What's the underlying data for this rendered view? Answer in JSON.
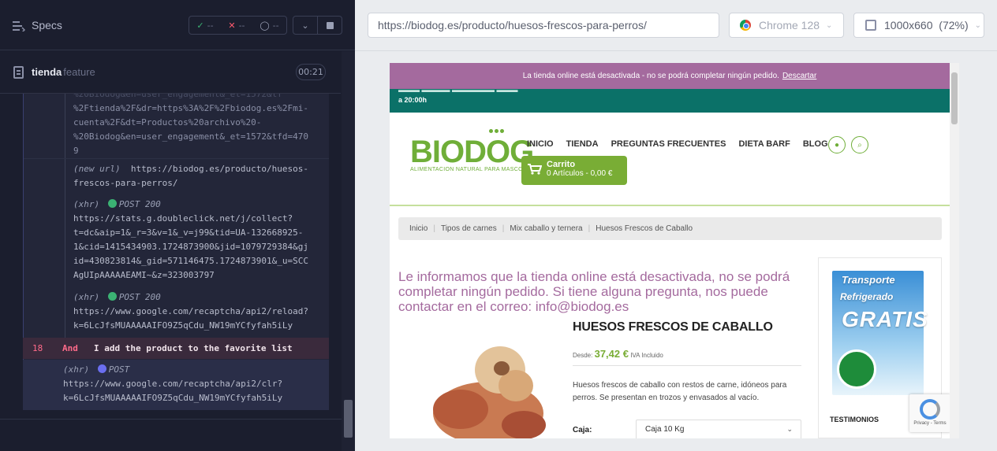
{
  "specs_bar": {
    "title": "Specs",
    "passed": "--",
    "failed": "--",
    "pending": "--"
  },
  "spec": {
    "name": "tienda",
    "type": "feature",
    "timer": "00:21"
  },
  "log": {
    "block1": [
      "%2Ftienda%2F&dr=https%3A%2F%2Fbiodog.es%2Fmi-",
      "cuenta%2F&dt=Productos%20archivo%20-",
      "%20Biodog&en=user_engagement&_et=1572&tfd=470",
      "9"
    ],
    "new_url_label": "(new url)",
    "new_url": "https://biodog.es/producto/huesos-frescos-para-perros/",
    "new_url_line1": "https://biodog.es/producto/huesos-",
    "new_url_line2": "frescos-para-perros/",
    "xhr1_label": "(xhr)",
    "xhr1_method": "POST 200",
    "xhr1_lines": [
      "https://stats.g.doubleclick.net/j/collect?",
      "t=dc&aip=1&_r=3&v=1&_v=j99&tid=UA-132668925-",
      "1&cid=1415434903.1724873900&jid=1079729384&gj",
      "id=430823814&_gid=571146475.1724873901&_u=SCC",
      "AgUIpAAAAAEAMI~&z=323003797"
    ],
    "xhr2_label": "(xhr)",
    "xhr2_method": "POST 200",
    "xhr2_lines": [
      "https://www.google.com/recaptcha/api2/reload?",
      "k=6LcJfsMUAAAAAIFO9Z5qCdu_NW19mYCfyfah5iLy"
    ]
  },
  "step": {
    "number": "18",
    "keyword": "And",
    "text": "I add the product to the favorite list"
  },
  "pending_xhr": {
    "label": "(xhr)",
    "method": "POST",
    "lines": [
      "https://www.google.com/recaptcha/api2/clr?",
      "k=6LcJfsMUAAAAAIFO9Z5qCdu_NW19mYCfyfah5iLy"
    ]
  },
  "url_bar": {
    "url": "https://biodog.es/producto/huesos-frescos-para-perros/"
  },
  "browser": {
    "name": "Chrome 128"
  },
  "viewport": {
    "size": "1000x660",
    "scale": "(72%)"
  },
  "site": {
    "notice_text": "La tienda online está desactivada - no se podrá completar ningún pedido.",
    "notice_dismiss": "Descartar",
    "teal_text": "a 20:00h",
    "logo_text": "BIODOG",
    "logo_sub": "ALIMENTACION NATURAL PARA MASCOTAS",
    "nav": [
      "INICIO",
      "TIENDA",
      "PREGUNTAS FRECUENTES",
      "DIETA BARF",
      "BLOG"
    ],
    "cart_title": "Carrito",
    "cart_detail": "0 Artículos - 0,00 €",
    "breadcrumb": [
      "Inicio",
      "Tipos de carnes",
      "Mix caballo y ternera",
      "Huesos Frescos de Caballo"
    ],
    "message": "Le informamos que la tienda online está desactivada, no se podrá completar ningún pedido. Si tiene alguna pregunta, nos puede contactar en el correo: info@biodog.es",
    "product_title": "HUESOS FRESCOS DE CABALLO",
    "price_prefix": "Desde:",
    "price": "37,42 €",
    "price_suffix": "IVA Incluido",
    "description": "Huesos frescos de caballo con restos de carne, idóneos para perros. Se presentan en trozos y envasados al vacío.",
    "caja_label": "Caja:",
    "caja_value": "Caja 10 Kg",
    "promo_line1": "Transporte",
    "promo_line2": "Refrigerado",
    "promo_line3": "GRATIS",
    "testimonios": "TESTIMONIOS",
    "recaptcha_text": "Privacy - Terms"
  },
  "colors": {
    "notice_bg": "#a46a9e",
    "teal": "#0b7168",
    "brand_green": "#79ad35",
    "message_purple": "#a46a9e",
    "step_highlight": "#3a2a3c"
  }
}
